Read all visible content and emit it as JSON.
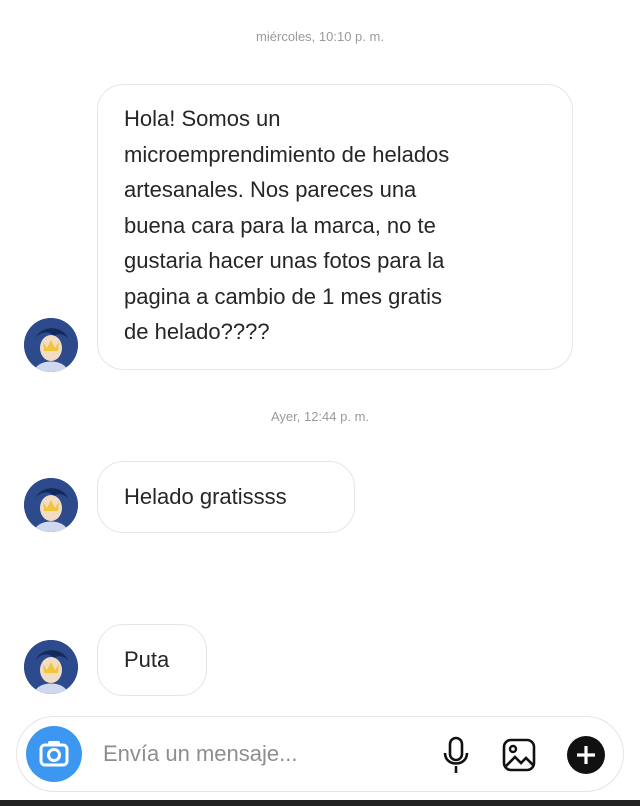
{
  "conversation": {
    "timestamps": [
      "miércoles, 10:10 p. m.",
      "Ayer, 12:44 p. m."
    ],
    "messages": [
      {
        "lines": [
          "Hola! Somos un",
          "microemprendimiento de helados",
          "artesanales. Nos pareces una",
          "buena cara para la marca, no te",
          "gustaria hacer unas fotos para la",
          "pagina a cambio de 1 mes gratis",
          "de helado????"
        ]
      },
      {
        "text": "Helado gratissss"
      },
      {
        "text": "Puta"
      }
    ]
  },
  "composer": {
    "placeholder": "Envía un mensaje...",
    "icons": [
      "camera-icon",
      "microphone-icon",
      "image-icon",
      "plus-icon"
    ]
  },
  "colors": {
    "accent": "#3b97f0",
    "avatar_bg": "#2c4a8c",
    "bubble_border": "#e6e6e6"
  }
}
